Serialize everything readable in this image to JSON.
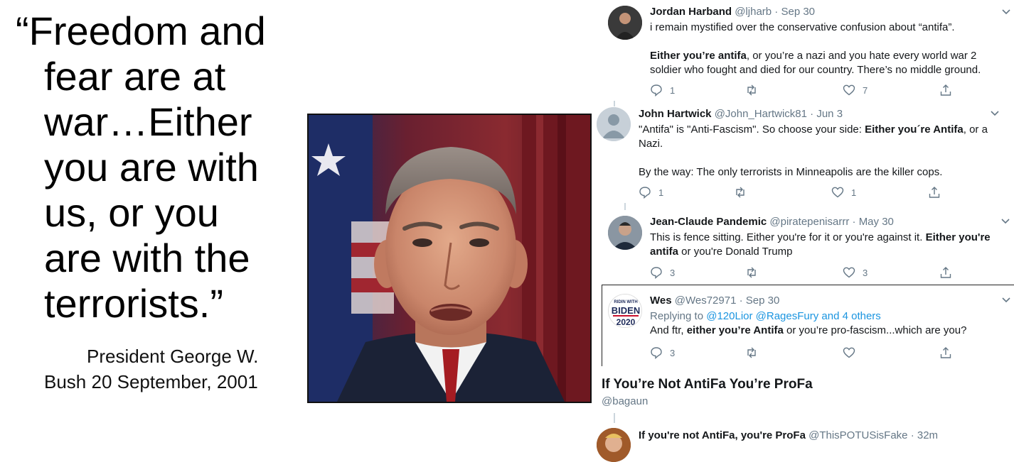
{
  "quote": {
    "lines": [
      "“Freedom and",
      "fear are at",
      "war…Either",
      "you are with",
      "us, or you",
      "are with the",
      "terrorists.”"
    ],
    "attribution": [
      "President George W.",
      "Bush 20 September, 2001"
    ]
  },
  "tweets": [
    {
      "name": "Jordan Harband",
      "handle": "@ljharb",
      "time": "Sep 30",
      "body_1": "i remain mystified over the conservative confusion about “antifa”.",
      "body_2_bold": "Either you’re antifa",
      "body_2_rest": ", or you’re a nazi and you hate every world war 2 soldier who fought and died for our country. There’s no middle ground.",
      "replies": "1",
      "retweets": "",
      "likes": "7"
    },
    {
      "name": "John Hartwick",
      "handle": "@John_Hartwick81",
      "time": "Jun 3",
      "body_1a": "\"Antifa\" is \"Anti-Fascism\". So choose your side: ",
      "body_1b_bold": "Either you´re Antifa",
      "body_1c": ", or a Nazi.",
      "body_2": "By the way: The only terrorists in Minneapolis are the killer cops.",
      "replies": "1",
      "retweets": "",
      "likes": "1"
    },
    {
      "name": "Jean-Claude Pandemic",
      "handle": "@piratepenisarrr",
      "time": "May 30",
      "body_a": "This is fence sitting. Either you're for it or you're against it. ",
      "body_b_bold": "Either you're antifa",
      "body_c": " or you're Donald Trump",
      "replies": "3",
      "retweets": "",
      "likes": "3"
    },
    {
      "name": "Wes",
      "handle": "@Wes72971",
      "time": "Sep 30",
      "reply_prefix": "Replying to ",
      "reply_targets": "@120Lior @RagesFury and 4 others",
      "avatar_text_top": "RIDIN WITH",
      "avatar_text_mid": "BIDEN",
      "avatar_text_bot": "2020",
      "body_a": "And ftr, ",
      "body_b_bold": "either you’re Antifa",
      "body_c": " or you’re pro-fascism...which are you?",
      "replies": "3",
      "retweets": "",
      "likes": ""
    }
  ],
  "profa_card": {
    "title": "If You’re Not AntiFa You’re ProFa",
    "handle": "@bagaun"
  },
  "last_tweet": {
    "name": "If you're not AntiFa, you're ProFa",
    "handle": "@ThisPOTUSisFake",
    "time": "32m"
  },
  "separator": "·",
  "colors": {
    "secondary_text": "#657786",
    "link": "#1b95e0",
    "primary_text": "#14171a"
  },
  "icons": [
    "reply-icon",
    "retweet-icon",
    "like-icon",
    "share-icon",
    "chevron-down-icon"
  ]
}
